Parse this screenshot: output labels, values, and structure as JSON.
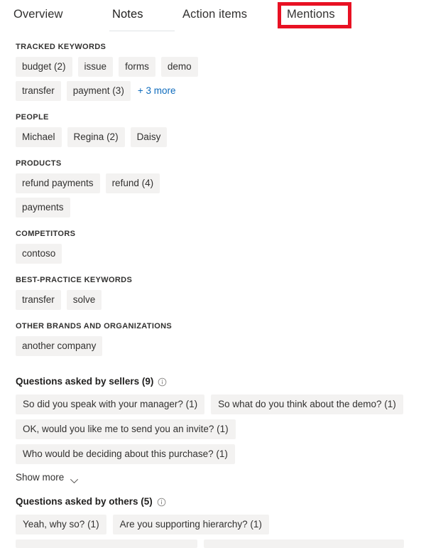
{
  "tabs": [
    {
      "label": "Overview",
      "active": false
    },
    {
      "label": "Notes",
      "active": true
    },
    {
      "label": "Action items",
      "active": false
    },
    {
      "label": "Mentions",
      "active": false,
      "highlighted": true
    }
  ],
  "colors": {
    "chip_bg": "#f3f2f1",
    "link": "#0f6cbd",
    "annotation": "#e81123",
    "text": "#323130",
    "tab_underline": "#dfe3e6"
  },
  "keyword_groups": [
    {
      "title": "TRACKED KEYWORDS",
      "rows": [
        {
          "chips": [
            "budget (2)",
            "issue",
            "forms",
            "demo"
          ]
        },
        {
          "chips": [
            "transfer",
            "payment (3)"
          ],
          "more_link": "+ 3 more"
        }
      ]
    },
    {
      "title": "PEOPLE",
      "rows": [
        {
          "chips": [
            "Michael",
            "Regina (2)",
            "Daisy"
          ]
        }
      ]
    },
    {
      "title": "PRODUCTS",
      "rows": [
        {
          "chips": [
            "refund payments",
            "refund (4)"
          ]
        },
        {
          "chips": [
            "payments"
          ]
        }
      ]
    },
    {
      "title": "COMPETITORS",
      "rows": [
        {
          "chips": [
            "contoso"
          ]
        }
      ]
    },
    {
      "title": "BEST-PRACTICE KEYWORDS",
      "rows": [
        {
          "chips": [
            "transfer",
            "solve"
          ]
        }
      ]
    },
    {
      "title": "OTHER BRANDS AND ORGANIZATIONS",
      "rows": [
        {
          "chips": [
            "another company"
          ]
        }
      ]
    }
  ],
  "questions_sellers": {
    "heading": "Questions asked by sellers (9)",
    "info_icon": "info-circle-icon",
    "rows": [
      [
        "So did you speak with your manager? (1)",
        "So what do you think about the demo? (1)"
      ],
      [
        "OK, would you like me to send you an invite? (1)",
        "Who would be deciding about this purchase? (1)"
      ]
    ],
    "show_more_label": "Show more",
    "show_more_icon": "chevron-down-icon"
  },
  "questions_others": {
    "heading": "Questions asked by others (5)",
    "info_icon": "info-circle-icon",
    "rows": [
      [
        "Yeah, why so? (1)",
        "Are you supporting hierarchy? (1)"
      ]
    ]
  }
}
